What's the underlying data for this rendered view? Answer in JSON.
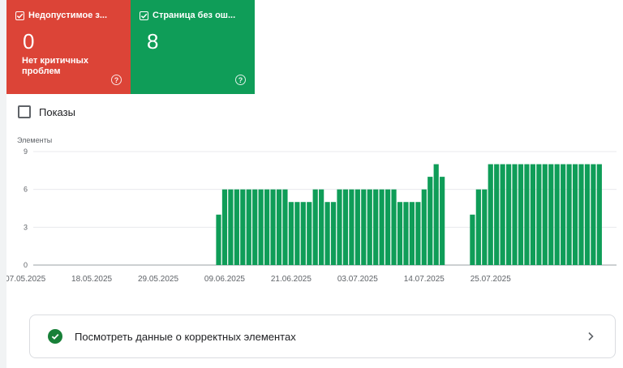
{
  "cards": {
    "invalid": {
      "title": "Недопустимое з...",
      "count": "0",
      "subtitle": "Нет критичных проблем",
      "color": "#dc4437",
      "icon": "help-icon"
    },
    "valid": {
      "title": "Страница без ош...",
      "count": "8",
      "color": "#0f9d58",
      "icon": "help-icon"
    }
  },
  "impressions_toggle": {
    "label": "Показы",
    "checked": false
  },
  "chart_data": {
    "type": "bar",
    "ylabel": "Элементы",
    "ylim": [
      0,
      9
    ],
    "yticks": [
      0,
      3,
      6,
      9
    ],
    "x_tick_labels": [
      "07.05.2025",
      "18.05.2025",
      "29.05.2025",
      "09.06.2025",
      "21.06.2025",
      "03.07.2025",
      "14.07.2025",
      "25.07.2025"
    ],
    "series": [
      {
        "values": [
          0,
          0,
          0,
          0,
          0,
          0,
          0,
          0,
          0,
          0,
          0,
          0,
          0,
          0,
          0,
          0,
          0,
          0,
          0,
          0,
          0,
          0,
          0,
          0,
          0,
          0,
          0,
          0,
          0,
          0,
          0,
          0,
          4,
          6,
          6,
          6,
          6,
          6,
          6,
          6,
          6,
          6,
          6,
          6,
          5,
          5,
          5,
          5,
          6,
          6,
          5,
          5,
          6,
          6,
          6,
          6,
          6,
          6,
          6,
          6,
          6,
          6,
          5,
          5,
          5,
          5,
          6,
          7,
          8,
          7,
          0,
          0,
          0,
          0,
          4,
          6,
          6,
          8,
          8,
          8,
          8,
          8,
          8,
          8,
          8,
          8,
          8,
          8,
          8,
          8,
          8,
          8,
          8,
          8,
          8,
          8
        ]
      }
    ],
    "bar_color": "#0f9d58",
    "grid": true
  },
  "valid_link": {
    "label": "Посмотреть данные о корректных элементах",
    "icon": "check-circle-icon",
    "chevron_icon": "chevron-right-icon"
  }
}
